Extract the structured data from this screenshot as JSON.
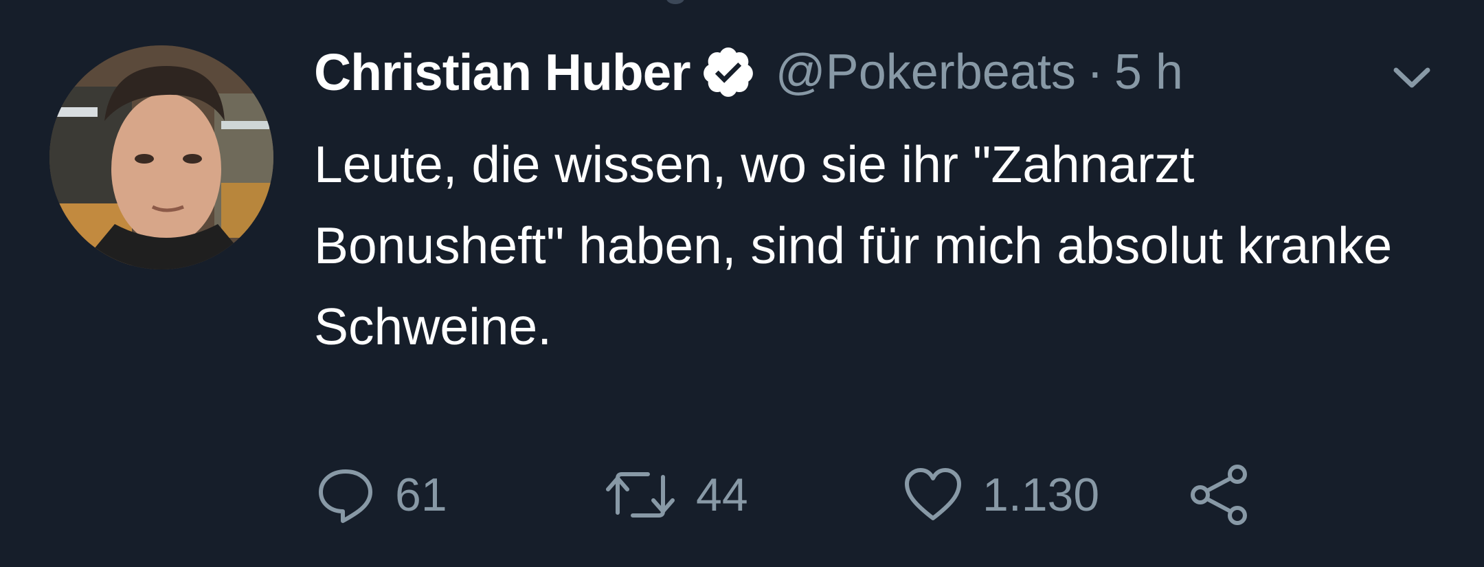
{
  "tweet": {
    "author_name": "Christian Huber",
    "handle": "@Pokerbeats",
    "separator": "·",
    "time": "5 h",
    "text": "Leute, die wissen, wo sie ihr \"Zahnarzt Bonusheft\" haben, sind für mich absolut kranke Schweine.",
    "verified": true
  },
  "actions": {
    "replies": "61",
    "retweets": "44",
    "likes": "1.130"
  },
  "icons": {
    "verified": "verified-badge-icon",
    "menu": "chevron-down-icon",
    "reply": "reply-icon",
    "retweet": "retweet-icon",
    "like": "heart-icon",
    "share": "share-icon"
  },
  "colors": {
    "background": "#161e2a",
    "primary_text": "#ffffff",
    "secondary_text": "#8899a6"
  }
}
